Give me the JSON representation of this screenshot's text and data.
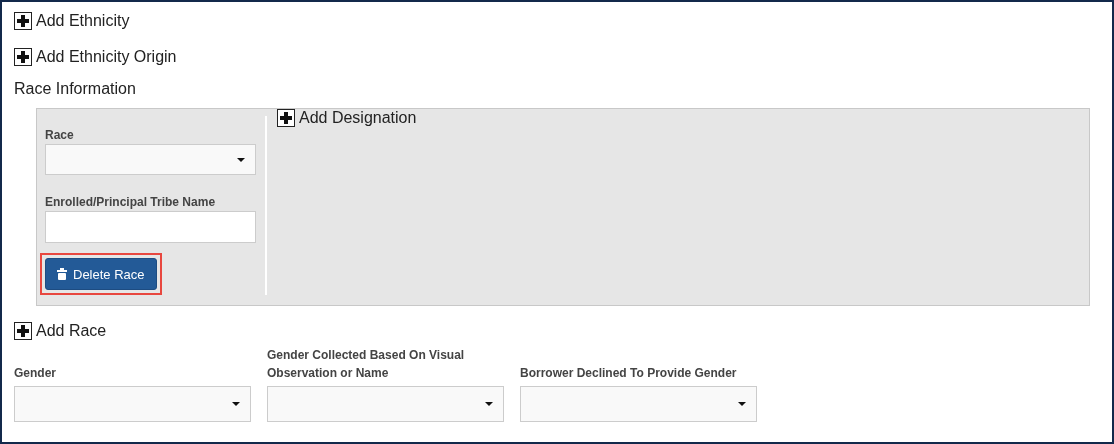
{
  "add_links_top": [
    "Add Ethnicity",
    "Add Ethnicity Origin"
  ],
  "race_section": {
    "title": "Race Information",
    "race_select": {
      "label": "Race"
    },
    "tribe_field": {
      "label": "Enrolled/Principal Tribe Name"
    },
    "delete_button": {
      "label": "Delete Race",
      "highlighted": true
    },
    "add_designation": "Add Designation"
  },
  "add_race": "Add Race",
  "gender_fields": [
    {
      "label": "Gender"
    },
    {
      "label": "Gender Collected Based On Visual Observation or Name"
    },
    {
      "label": "Borrower Declined To Provide Gender"
    }
  ]
}
